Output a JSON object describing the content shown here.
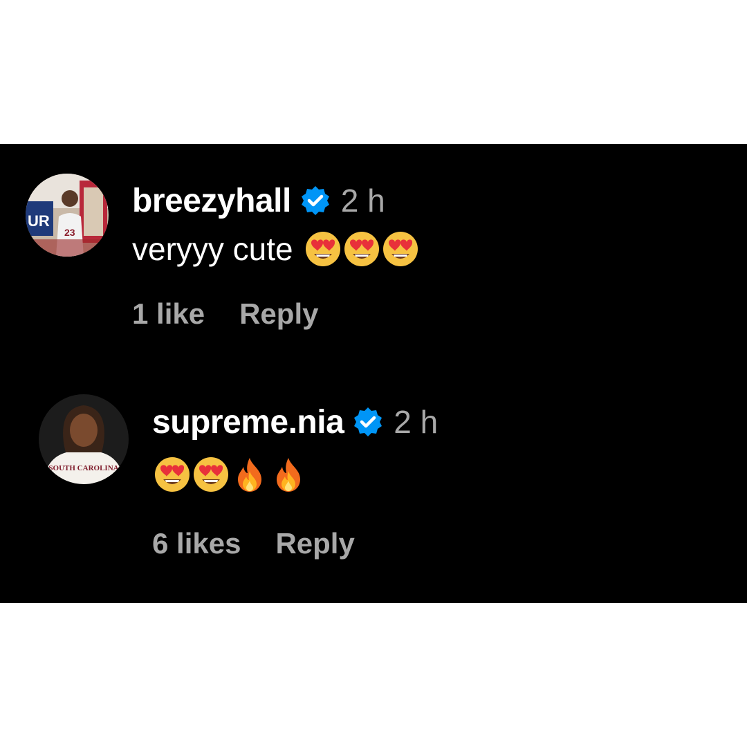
{
  "comments": [
    {
      "username": "breezyhall",
      "time": "2 h",
      "text": "veryyy cute",
      "emojis": [
        "heart-eyes",
        "heart-eyes",
        "heart-eyes"
      ],
      "likes": "1 like",
      "reply_label": "Reply"
    },
    {
      "username": "supreme.nia",
      "time": "2 h",
      "text": "",
      "emojis": [
        "heart-eyes",
        "heart-eyes",
        "fire",
        "fire"
      ],
      "likes": "6 likes",
      "reply_label": "Reply"
    }
  ],
  "avatar_details": {
    "breezyhall_sign_text": "UR",
    "breezyhall_jersey_number": "23",
    "supreme_nia_shirt_text": "SOUTH CAROLINA"
  },
  "colors": {
    "background": "#000000",
    "username": "#ffffff",
    "secondary_text": "#a8a8a8",
    "verified_badge": "#0095f6"
  }
}
